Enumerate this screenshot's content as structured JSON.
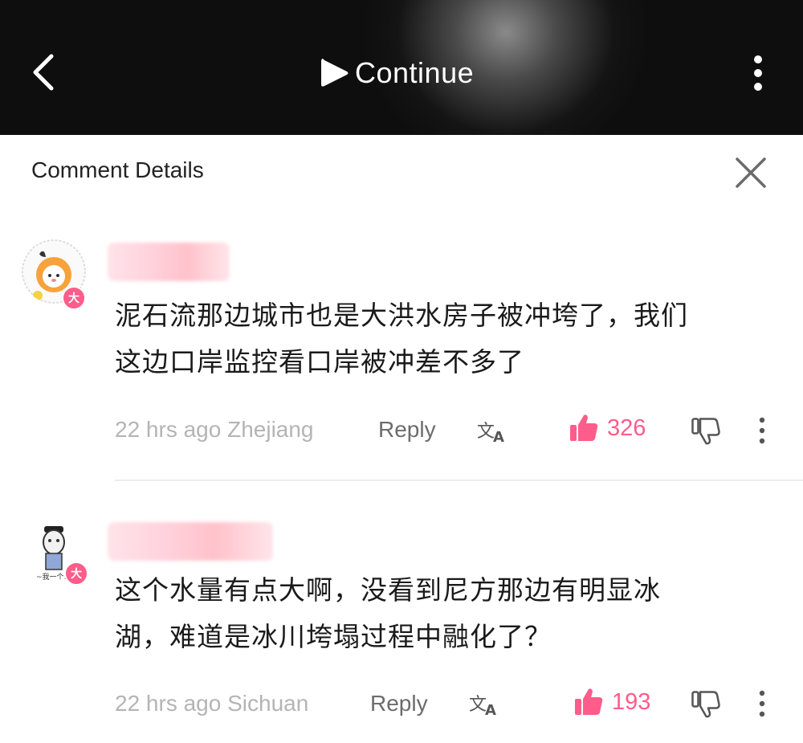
{
  "top_bar": {
    "continue_label": "Continue",
    "back_icon": "chevron-left-icon",
    "play_icon": "play-icon",
    "more_icon": "vertical-dots-icon"
  },
  "panel": {
    "title": "Comment Details",
    "close_icon": "close-icon"
  },
  "comments": [
    {
      "badge": "大",
      "text_line1": "泥石流那边城市也是大洪水房子被冲垮了，我们",
      "text_line2": "这边口岸监控看口岸被冲差不多了",
      "meta": "22 hrs ago Zhejiang",
      "reply_label": "Reply",
      "likes": "326"
    },
    {
      "badge": "大",
      "text_line1": "这个水量有点大啊，没看到尼方那边有明显冰",
      "text_line2": "湖，难道是冰川垮塌过程中融化了？",
      "meta": "22 hrs ago Sichuan",
      "reply_label": "Reply",
      "likes": "193"
    }
  ],
  "colors": {
    "accent": "#fe5c8a",
    "meta_text": "#b4b4b4",
    "top_bar_bg": "#111111"
  }
}
